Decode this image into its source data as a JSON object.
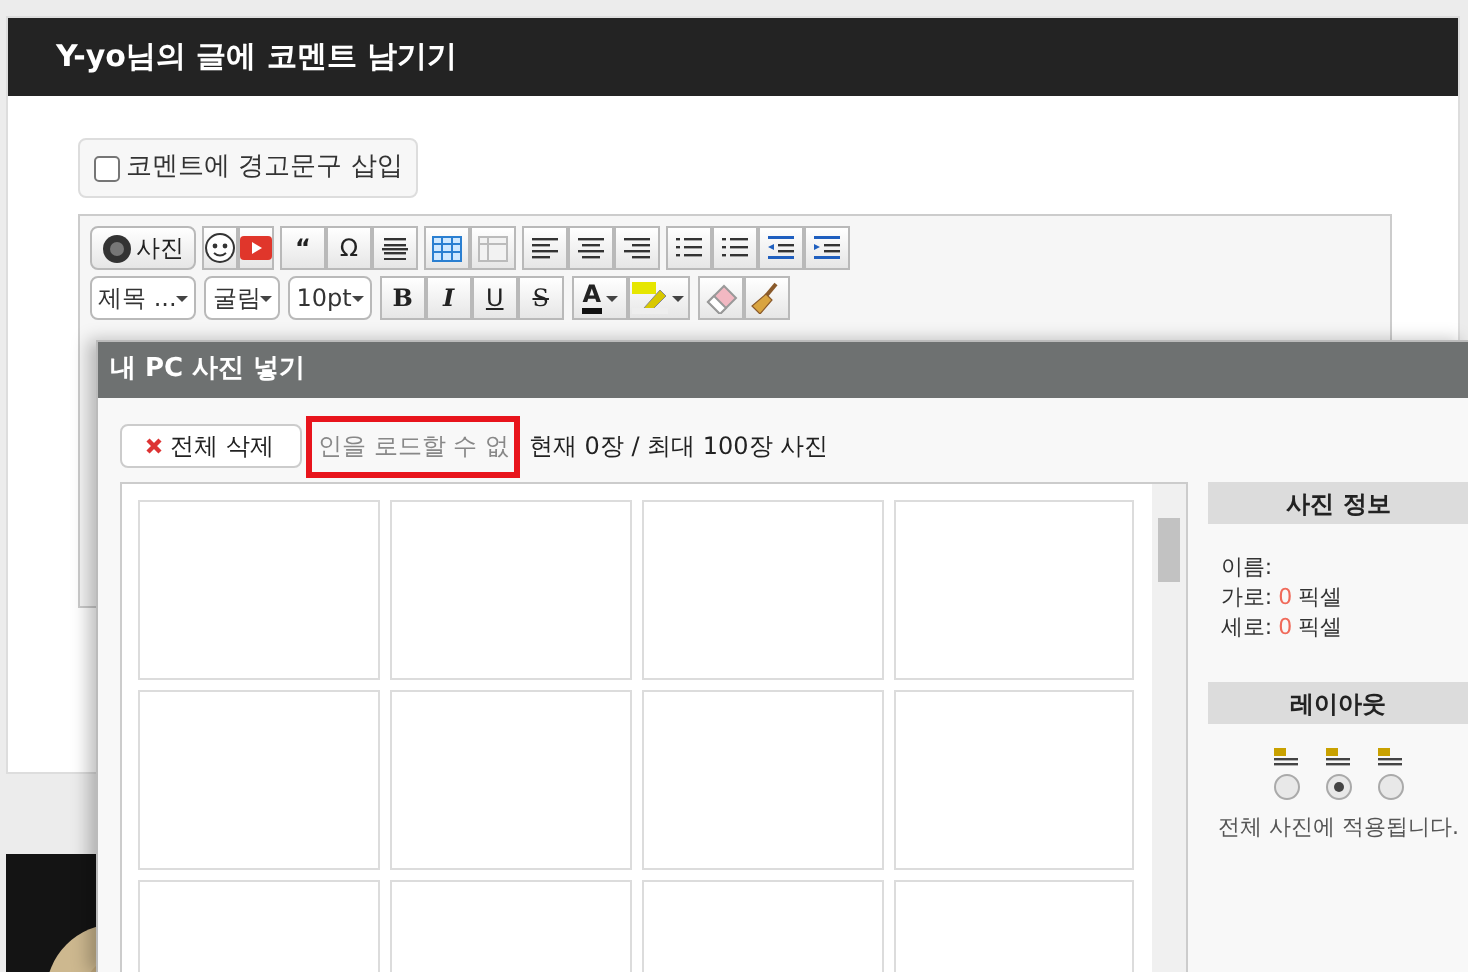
{
  "page": {
    "title": "Y-yo님의 글에 코멘트 남기기",
    "warning_option": {
      "label": "코멘트에 경고문구 삽입",
      "checked": false
    }
  },
  "toolbar": {
    "photo": "사진",
    "quote": "“",
    "omega": "Ω",
    "heading": "제목 ...",
    "font": "굴림",
    "size": "10pt",
    "bold": "B",
    "italic": "I",
    "underline": "U",
    "strike": "S",
    "text_color": "A"
  },
  "dialog": {
    "title": "내 PC 사진 넣기",
    "delete_all": "전체 삭제",
    "error_text": "인을 로드할 수 없",
    "count_text": "현재 0장 / 최대 100장 사진",
    "info_header": "사진 정보",
    "info": [
      {
        "label": "이름:"
      },
      {
        "label": "가로:",
        "value": "0",
        "unit": "픽셀"
      },
      {
        "label": "세로:",
        "value": "0",
        "unit": "픽셀"
      }
    ],
    "layout_header": "레이아웃",
    "layouts": [
      {
        "selected": false
      },
      {
        "selected": true
      },
      {
        "selected": false
      }
    ],
    "layout_note": "전체 사진에 적용됩니다."
  }
}
